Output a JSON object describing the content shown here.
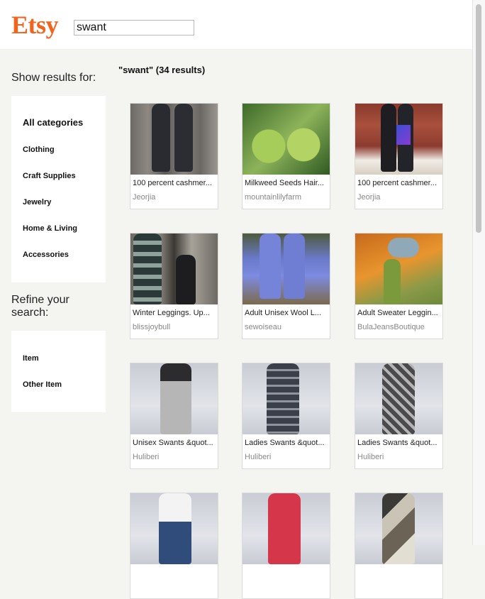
{
  "header": {
    "logo": "Etsy",
    "search_value": "swant"
  },
  "sidebar": {
    "show_results_title": "Show results for:",
    "categories": [
      "All categories",
      "Clothing",
      "Craft Supplies",
      "Jewelry",
      "Home & Living",
      "Accessories"
    ],
    "refine_title": "Refine your search:",
    "refine_items": [
      "Item",
      "Other Item"
    ]
  },
  "results": {
    "heading": "\"swant\" (34 results)",
    "items": [
      {
        "title": "100 percent cashmer...",
        "shop": "Jeorjia"
      },
      {
        "title": "Milkweed Seeds Hair...",
        "shop": "mountainlilyfarm"
      },
      {
        "title": "100 percent cashmer...",
        "shop": "Jeorjia"
      },
      {
        "title": "Winter Leggings. Up...",
        "shop": "blissjoybull"
      },
      {
        "title": "Adult Unisex Wool L...",
        "shop": "sewoiseau"
      },
      {
        "title": "Adult Sweater Leggin...",
        "shop": "BulaJeansBoutique"
      },
      {
        "title": "Unisex Swants &quot...",
        "shop": "Huliberi"
      },
      {
        "title": "Ladies Swants &quot...",
        "shop": "Huliberi"
      },
      {
        "title": "Ladies Swants &quot...",
        "shop": "Huliberi"
      },
      {
        "title": "",
        "shop": ""
      },
      {
        "title": "",
        "shop": ""
      },
      {
        "title": "",
        "shop": ""
      }
    ]
  },
  "colors": {
    "brand": "#f1641e",
    "page_bg": "#f4f4f1"
  }
}
